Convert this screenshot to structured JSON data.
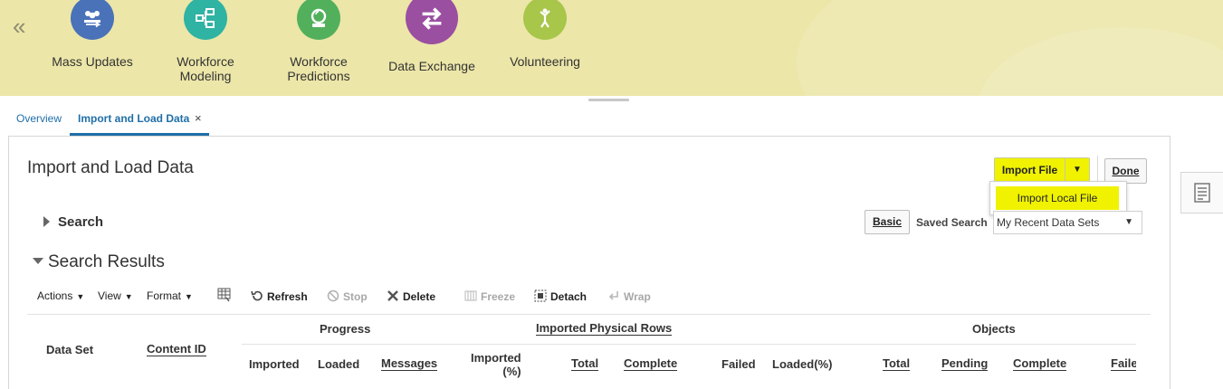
{
  "collapse_icon": "double-chevron-left-icon",
  "apps": [
    {
      "label": "Mass Updates",
      "icon": "users-update-icon",
      "color": "#4a72b8"
    },
    {
      "label": "Workforce\nModeling",
      "icon": "flow-icon",
      "color": "#2fb3a3"
    },
    {
      "label": "Workforce\nPredictions",
      "icon": "crystal-ball-icon",
      "color": "#52b05c"
    },
    {
      "label": "Data Exchange",
      "icon": "swap-arrows-icon",
      "color": "#9a4fa1"
    },
    {
      "label": "Volunteering",
      "icon": "volunteer-icon",
      "color": "#a8c64a"
    }
  ],
  "tabs": {
    "overview": "Overview",
    "active": "Import and Load Data",
    "close": "×"
  },
  "page_title": "Import and Load Data",
  "import_button": {
    "label": "Import File",
    "arrow": "▼"
  },
  "done_button": "Done",
  "import_menu": {
    "item": "Import Local File"
  },
  "search": {
    "heading": "Search",
    "basic": "Basic",
    "saved_label": "Saved Search",
    "saved_value": "My Recent Data Sets",
    "caret": "▼"
  },
  "results": {
    "heading": "Search Results"
  },
  "toolbar": {
    "actions": "Actions",
    "view": "View",
    "format": "Format",
    "refresh": "Refresh",
    "stop": "Stop",
    "delete": "Delete",
    "freeze": "Freeze",
    "detach": "Detach",
    "wrap": "Wrap",
    "dd": "▼"
  },
  "table": {
    "groups": {
      "progress": "Progress",
      "imported_rows": "Imported Physical Rows",
      "objects": "Objects"
    },
    "columns": {
      "data_set": "Data Set",
      "content_id": "Content ID",
      "imported": "Imported",
      "loaded": "Loaded",
      "messages": "Messages",
      "imported_pct_1": "Imported",
      "imported_pct_2": "(%)",
      "total": "Total",
      "complete": "Complete",
      "failed": "Failed",
      "loaded_pct": "Loaded(%)",
      "obj_total": "Total",
      "obj_pending": "Pending",
      "obj_complete": "Complete",
      "obj_failed": "Faile"
    }
  }
}
